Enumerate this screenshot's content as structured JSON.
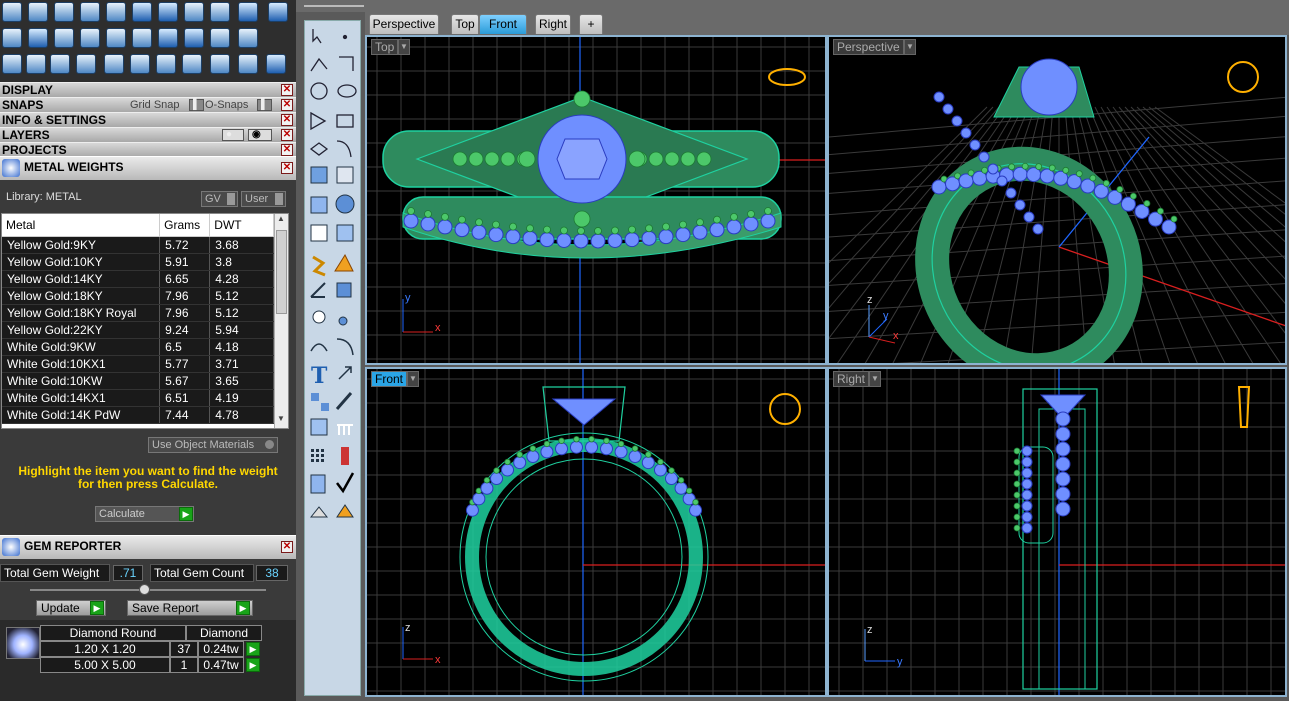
{
  "sections": {
    "display": "DISPLAY",
    "snaps": "SNAPS",
    "grid_snap": "Grid Snap",
    "o_snaps": "O-Snaps",
    "info": "INFO & SETTINGS",
    "layers": "LAYERS",
    "projects": "PROJECTS"
  },
  "metal_weights": {
    "title": "METAL WEIGHTS",
    "library": "Library: METAL",
    "gv": "GV",
    "user": "User",
    "columns": [
      "Metal",
      "Grams",
      "DWT"
    ],
    "rows": [
      [
        "Yellow Gold:9KY",
        "5.72",
        "3.68"
      ],
      [
        "Yellow Gold:10KY",
        "5.91",
        "3.8"
      ],
      [
        "Yellow Gold:14KY",
        "6.65",
        "4.28"
      ],
      [
        "Yellow Gold:18KY",
        "7.96",
        "5.12"
      ],
      [
        "Yellow Gold:18KY Royal",
        "7.96",
        "5.12"
      ],
      [
        "Yellow Gold:22KY",
        "9.24",
        "5.94"
      ],
      [
        "White Gold:9KW",
        "6.5",
        "4.18"
      ],
      [
        "White Gold:10KX1",
        "5.77",
        "3.71"
      ],
      [
        "White Gold:10KW",
        "5.67",
        "3.65"
      ],
      [
        "White Gold:14KX1",
        "6.51",
        "4.19"
      ],
      [
        "White Gold:14K PdW",
        "7.44",
        "4.78"
      ]
    ],
    "use_object_materials": "Use Object Materials",
    "instruction": "Highlight the item you want to find the weight for then press Calculate.",
    "calculate": "Calculate"
  },
  "gem_reporter": {
    "title": "GEM REPORTER",
    "total_gem_weight_label": "Total Gem Weight",
    "total_gem_weight": ".71",
    "total_gem_count_label": "Total Gem Count",
    "total_gem_count": "38",
    "update": "Update",
    "save_report": "Save Report",
    "shape_header": "Diamond Round",
    "material_header": "Diamond",
    "rows": [
      [
        "1.20 X 1.20",
        "37",
        "0.24tw"
      ],
      [
        "5.00 X 5.00",
        "1",
        "0.47tw"
      ]
    ]
  },
  "tabs": [
    "Perspective",
    "Top",
    "Front",
    "Right",
    "+"
  ],
  "active_tab": "Front",
  "viewports": {
    "top": {
      "title": "Top",
      "axis1": "y",
      "axis2": "x"
    },
    "perspective": {
      "title": "Perspective",
      "axis1": "z",
      "axis2": "y",
      "axis3": "x"
    },
    "front": {
      "title": "Front",
      "axis1": "z",
      "axis2": "x"
    },
    "right": {
      "title": "Right",
      "axis1": "z",
      "axis2": "y"
    }
  },
  "colors": {
    "metal": "#2e8b5e",
    "wire": "#1fd1a0",
    "gem": "#6f8fff",
    "accent": "#2aa5e6",
    "instruction": "#ffd700"
  }
}
